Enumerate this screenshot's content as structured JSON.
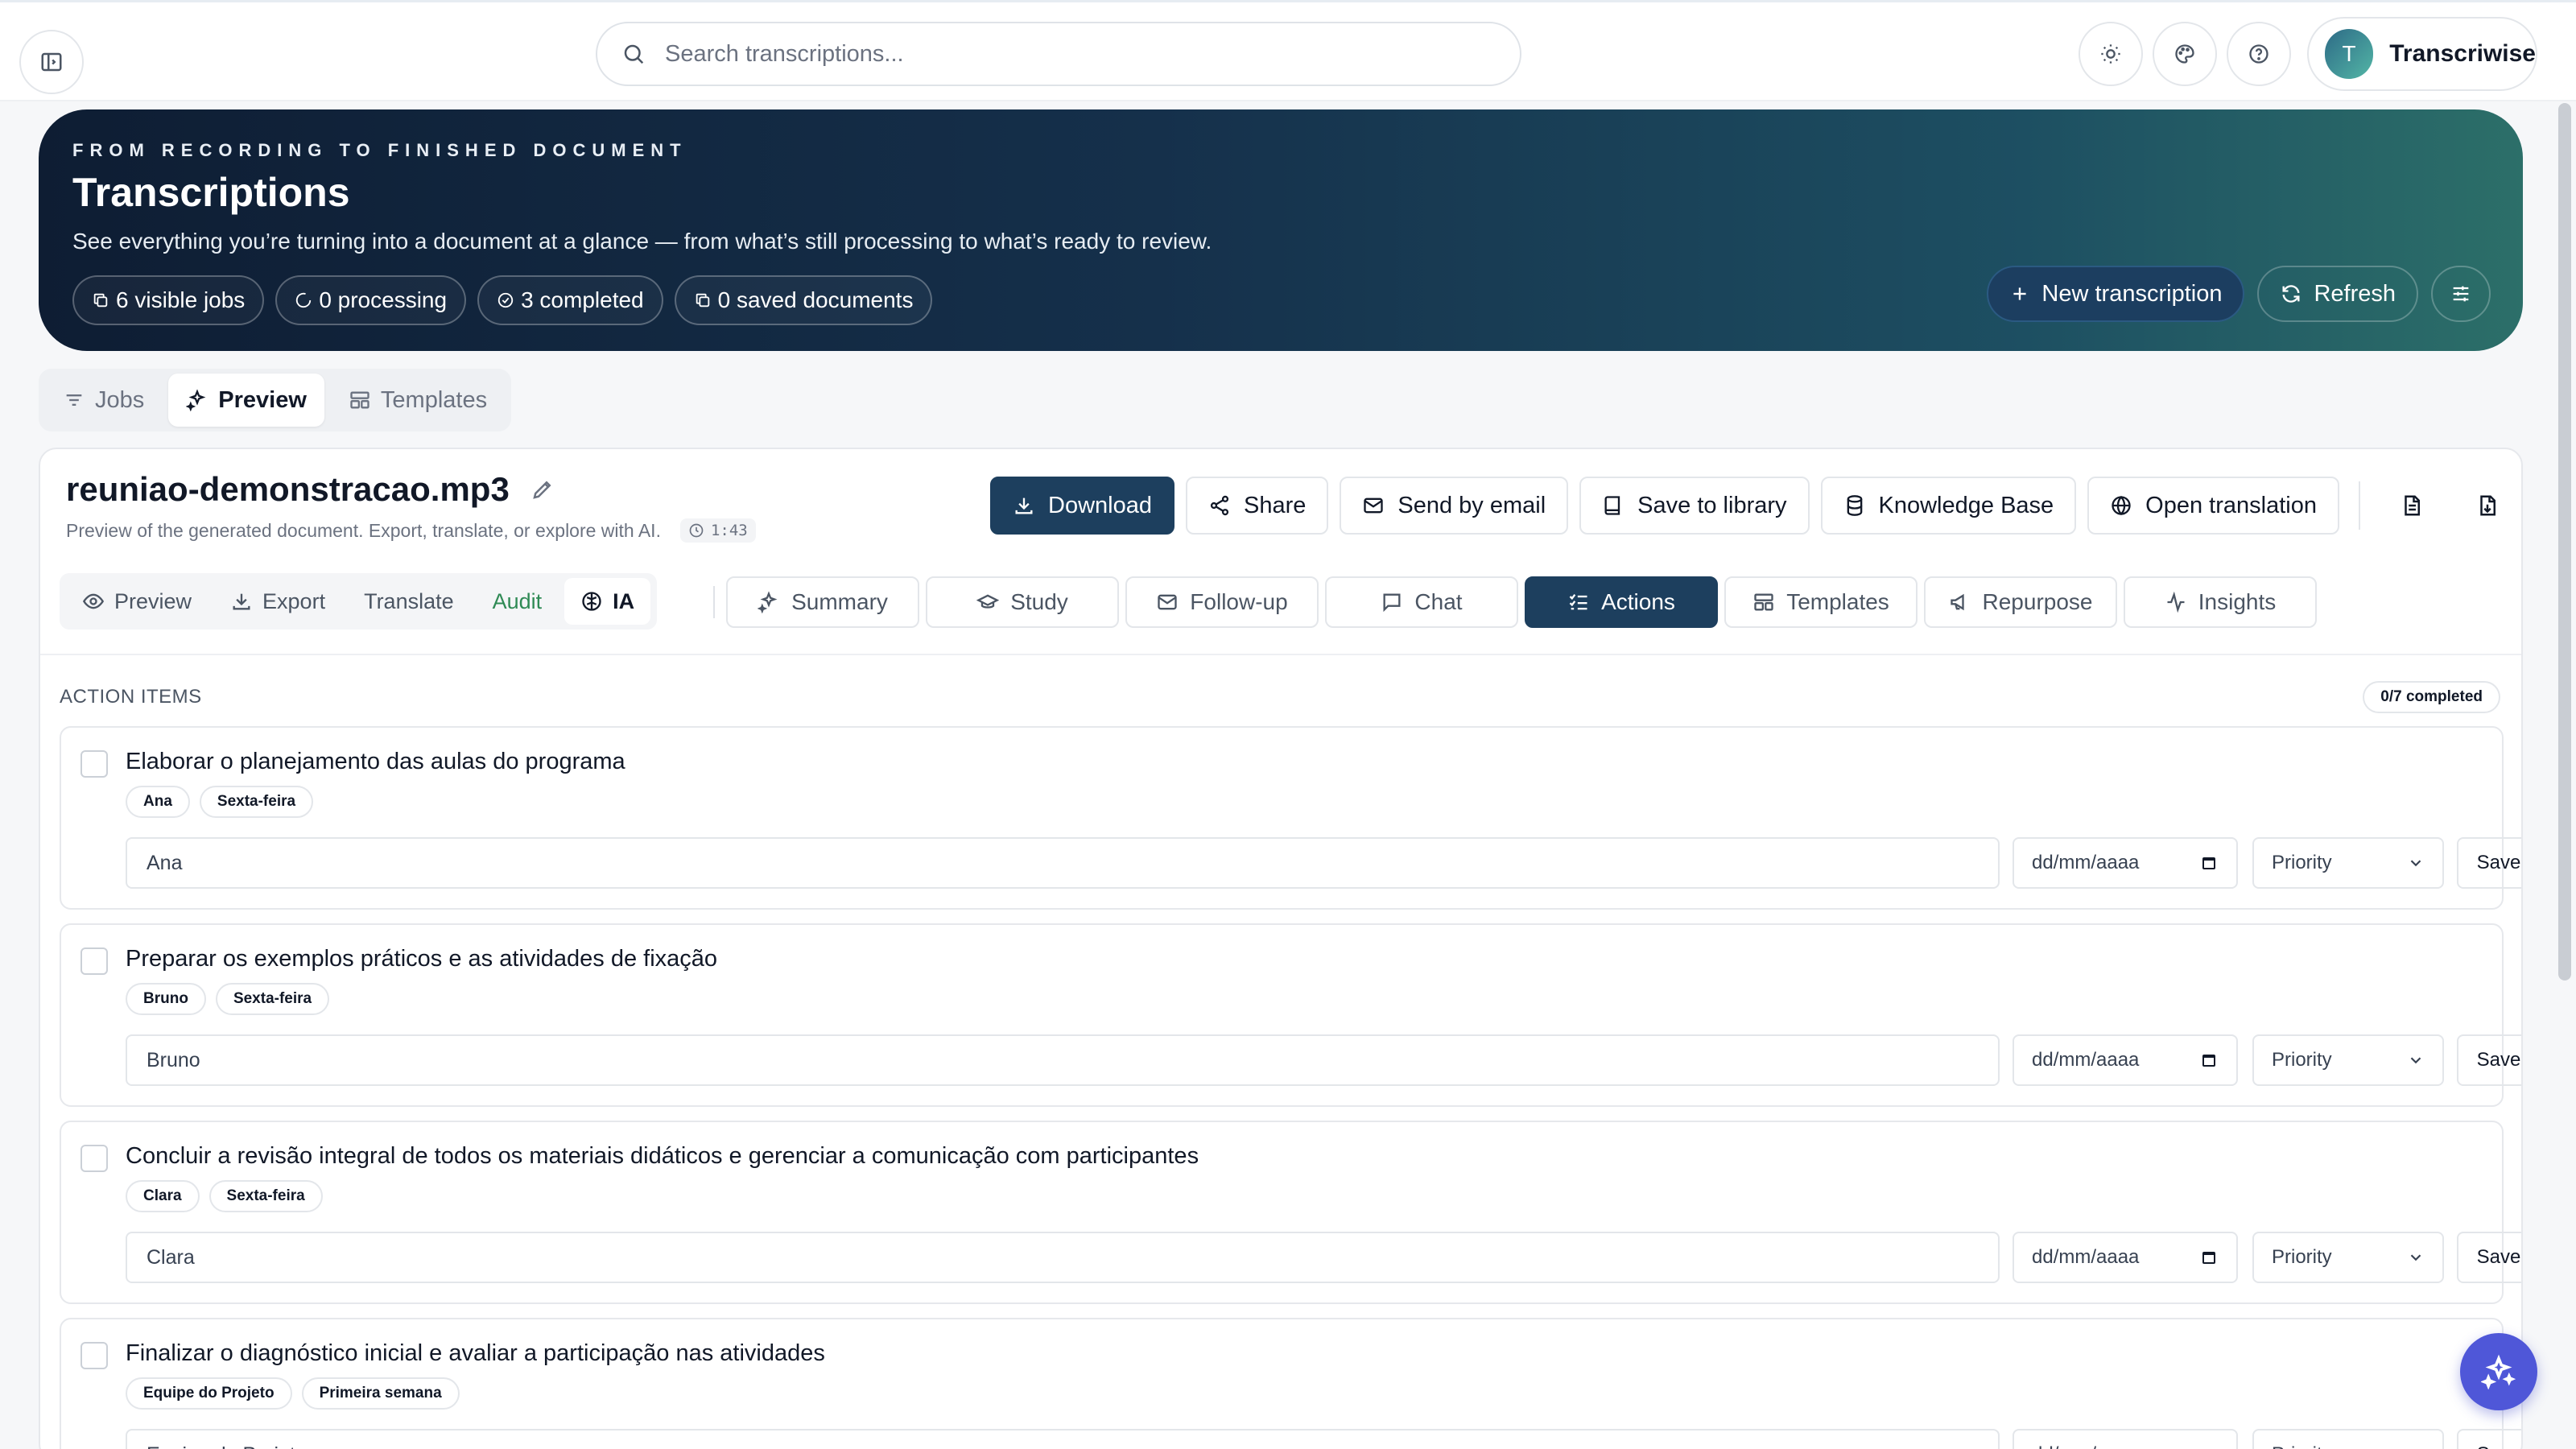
{
  "search": {
    "placeholder": "Search transcriptions..."
  },
  "topbar": {
    "user_initial": "T",
    "user_name": "Transcriwise"
  },
  "hero": {
    "eyebrow": "FROM RECORDING TO FINISHED DOCUMENT",
    "title": "Transcriptions",
    "subtitle": "See everything you’re turning into a document at a glance — from what’s still processing to what’s ready to review.",
    "stats": [
      "6 visible jobs",
      "0 processing",
      "3 completed",
      "0 saved documents"
    ],
    "new_label": "New transcription",
    "refresh_label": "Refresh"
  },
  "view_tabs": [
    "Jobs",
    "Preview",
    "Templates"
  ],
  "file": {
    "name": "reuniao-demonstracao.mp3",
    "description": "Preview of the generated document. Export, translate, or explore with AI.",
    "duration": "1:43",
    "actions": [
      "Download",
      "Share",
      "Send by email",
      "Save to library",
      "Knowledge Base",
      "Open translation"
    ]
  },
  "mode_tabs": [
    "Preview",
    "Export",
    "Translate",
    "Audit",
    "IA"
  ],
  "ai_tabs": [
    "Summary",
    "Study",
    "Follow-up",
    "Chat",
    "Actions",
    "Templates",
    "Repurpose",
    "Insights"
  ],
  "actions_panel": {
    "title": "ACTION ITEMS",
    "progress": "0/7 completed",
    "date_placeholder": "dd/mm/aaaa",
    "priority_label": "Priority",
    "save_label": "Save",
    "items": [
      {
        "text": "Elaborar o planejamento das aulas do programa",
        "tags": [
          "Ana",
          "Sexta-feira"
        ],
        "assignee": "Ana"
      },
      {
        "text": "Preparar os exemplos práticos e as atividades de fixação",
        "tags": [
          "Bruno",
          "Sexta-feira"
        ],
        "assignee": "Bruno"
      },
      {
        "text": "Concluir a revisão integral de todos os materiais didáticos e gerenciar a comunicação com participantes",
        "tags": [
          "Clara",
          "Sexta-feira"
        ],
        "assignee": "Clara"
      },
      {
        "text": "Finalizar o diagnóstico inicial e avaliar a participação nas atividades",
        "tags": [
          "Equipe do Projeto",
          "Primeira semana"
        ],
        "assignee": "Equipe do Projeto"
      }
    ]
  },
  "colors": {
    "primary": "#1d3f5e",
    "audit_green": "#2f8a55",
    "fab": "#4f57d8"
  }
}
